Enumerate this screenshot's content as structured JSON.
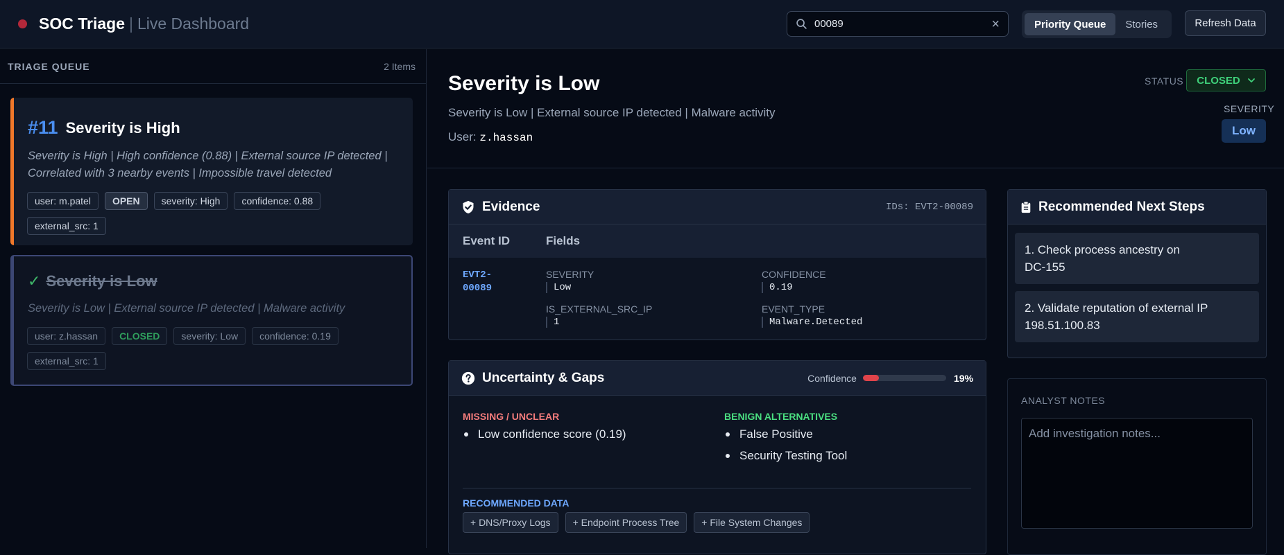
{
  "header": {
    "title": "SOC Triage",
    "separator": "|",
    "subtitle": "Live Dashboard",
    "search_value": "00089",
    "clear_label": "×",
    "tabs": [
      {
        "label": "Priority Queue",
        "active": true
      },
      {
        "label": "Stories",
        "active": false
      }
    ],
    "refresh_label": "Refresh Data"
  },
  "queue": {
    "title": "TRIAGE QUEUE",
    "count": "2 Items",
    "items": [
      {
        "number": "#11",
        "title": "Severity is High",
        "description": "Severity is High | High confidence (0.88) | External source IP detected | Correlated with 3 nearby events | Impossible travel detected",
        "tags": [
          "user: m.patel",
          "OPEN",
          "severity: High",
          "confidence: 0.88",
          "external_src: 1"
        ],
        "accent": "#f0782a"
      },
      {
        "check": "✓",
        "title": "Severity is Low",
        "description": "Severity is Low | External source IP detected | Malware activity",
        "tags": [
          "user: z.hassan",
          "CLOSED",
          "severity: Low",
          "confidence: 0.19",
          "external_src: 1"
        ],
        "accent": "#3c4775"
      }
    ]
  },
  "detail": {
    "title": "Severity is Low",
    "subtitle": "Severity is Low | External source IP detected | Malware activity",
    "user_label": "User:",
    "user_value": "z.hassan",
    "status_label": "STATUS",
    "status_value": "CLOSED",
    "severity_label": "SEVERITY",
    "severity_value": "Low"
  },
  "evidence": {
    "title": "Evidence",
    "ids": "IDs: EVT2-00089",
    "col_event_id": "Event ID",
    "col_fields": "Fields",
    "event_id_line1": "EVT2-",
    "event_id_line2": "00089",
    "fields": [
      {
        "label": "SEVERITY",
        "value": "Low"
      },
      {
        "label": "CONFIDENCE",
        "value": "0.19"
      },
      {
        "label": "IS_EXTERNAL_SRC_IP",
        "value": "1"
      },
      {
        "label": "EVENT_TYPE",
        "value": "Malware.Detected"
      }
    ]
  },
  "uncertainty": {
    "title": "Uncertainty & Gaps",
    "confidence_label": "Confidence",
    "confidence_value": 0.19,
    "confidence_pct": "19%",
    "missing_title": "MISSING / UNCLEAR",
    "missing_items": [
      "Low confidence score (0.19)"
    ],
    "benign_title": "BENIGN ALTERNATIVES",
    "benign_items": [
      "False Positive",
      "Security Testing Tool"
    ],
    "recommended_title": "RECOMMENDED DATA",
    "recommended_items": [
      "+ DNS/Proxy Logs",
      "+ Endpoint Process Tree",
      "+ File System Changes"
    ]
  },
  "next_steps": {
    "title": "Recommended Next Steps",
    "items": [
      "1. Check process ancestry on DC-155",
      "2. Validate reputation of external IP 198.51.100.83"
    ]
  },
  "notes": {
    "label": "ANALYST NOTES",
    "placeholder": "Add investigation notes..."
  },
  "colors": {
    "accent_blue": "#4a8ef0",
    "status_closed": "#3fd17a",
    "high_accent": "#f0782a",
    "danger": "#e0434a"
  }
}
